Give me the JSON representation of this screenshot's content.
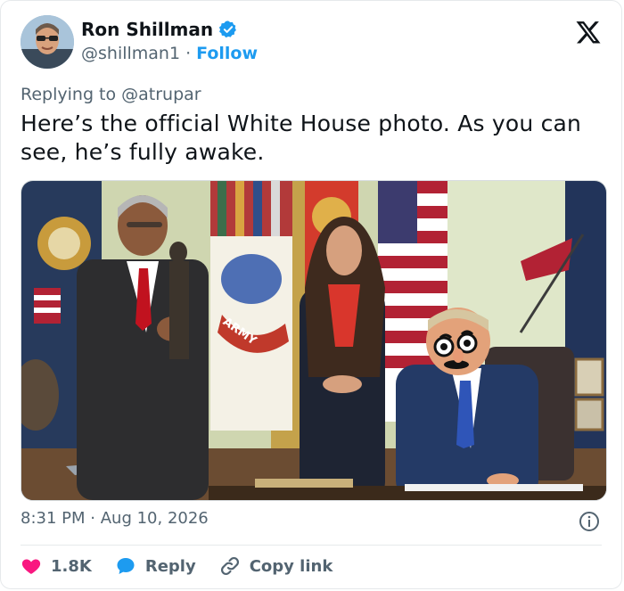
{
  "tweet": {
    "author_name": "Ron Shillman",
    "handle": "@shillman1",
    "separator": "·",
    "follow_label": "Follow",
    "replying_to_label": "Replying to @atrupar",
    "text": "Here’s the official White House photo. As you can see, he’s fully awake.",
    "time": "8:31 PM",
    "date": "Aug 10, 2026",
    "likes": "1.8K",
    "reply_label": "Reply",
    "copy_link_label": "Copy link"
  },
  "icons": {
    "verified": "verified-badge-icon",
    "logo": "x-logo-icon",
    "info": "info-icon",
    "like": "heart-icon",
    "reply": "speech-bubble-icon",
    "link": "link-icon"
  },
  "media": {
    "flag_text": "ARMY"
  },
  "colors": {
    "accent": "#1d9bf0",
    "like": "#f91880",
    "muted": "#536471",
    "text": "#0f1419"
  }
}
